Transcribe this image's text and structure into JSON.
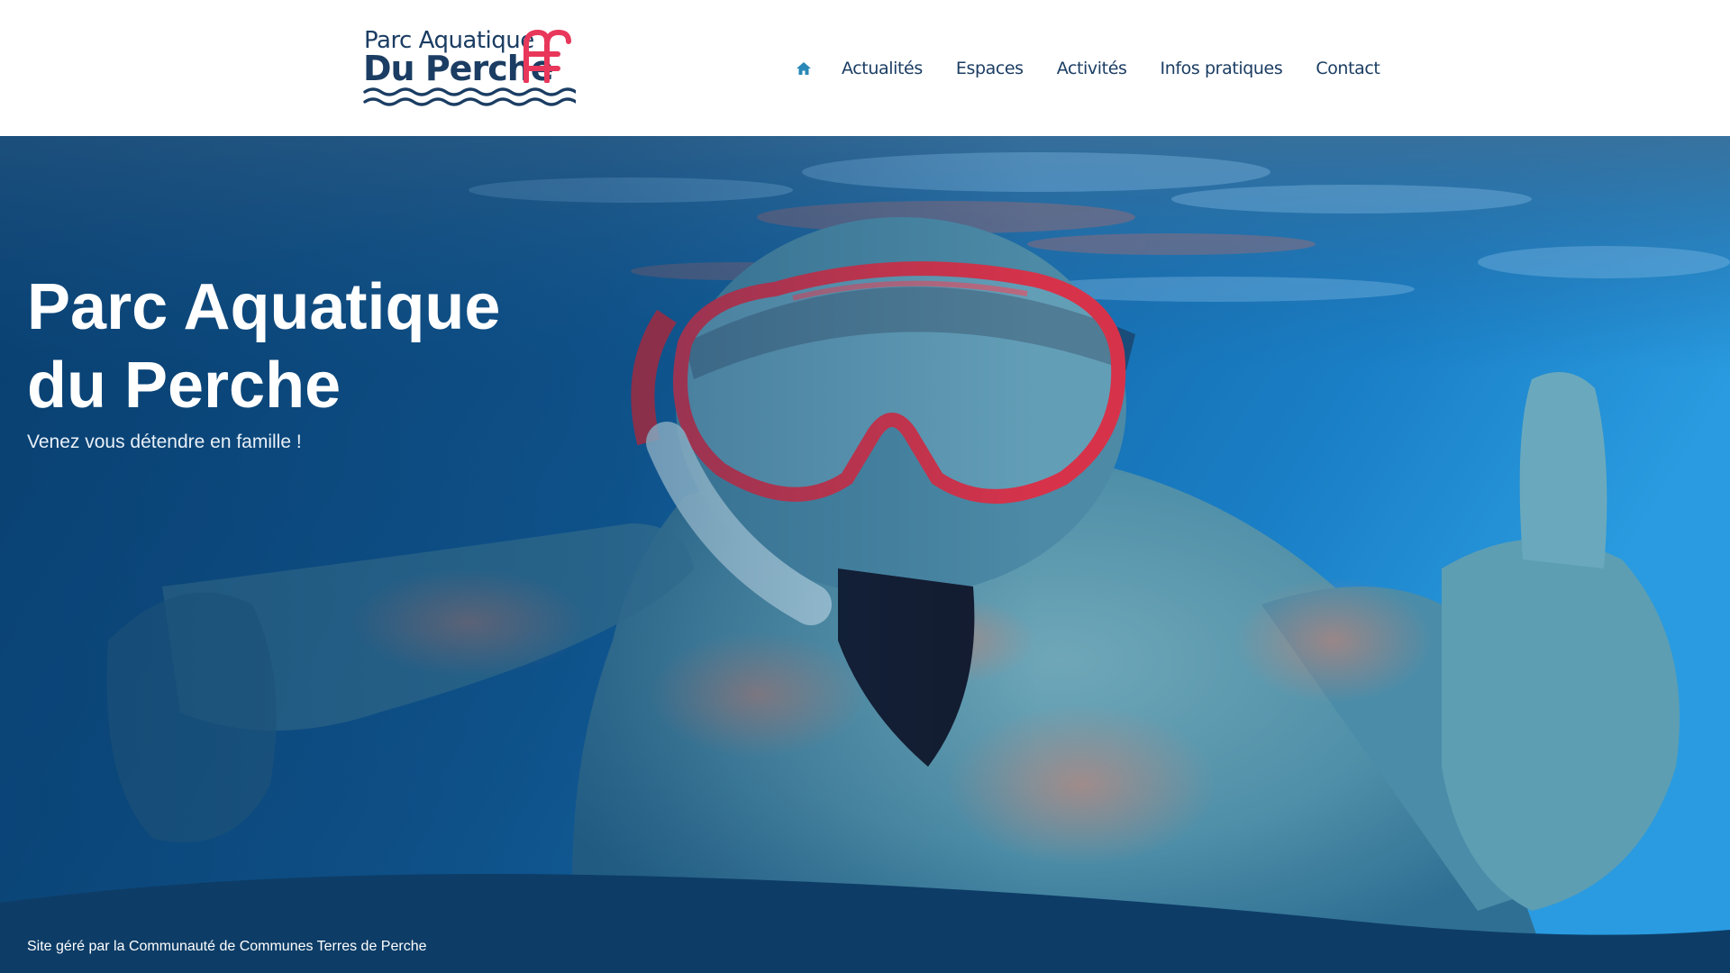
{
  "header": {
    "logo": {
      "line1": "Parc Aquatique",
      "line2": "Du Perche"
    },
    "nav": {
      "home_icon": "home-icon",
      "items": [
        {
          "label": "Actualités"
        },
        {
          "label": "Espaces"
        },
        {
          "label": "Activités"
        },
        {
          "label": "Infos pratiques"
        },
        {
          "label": "Contact"
        }
      ]
    }
  },
  "hero": {
    "title_line1": "Parc Aquatique",
    "title_line2": "du Perche",
    "subtitle": "Venez vous détendre en famille !",
    "image": "child-snorkeling-underwater-thumbs-up"
  },
  "footer": {
    "text": "Site géré par la Communauté de Communes Terres de Perche"
  },
  "colors": {
    "brand_navy": "#1b3d63",
    "brand_red": "#e8375a",
    "nav_home_accent": "#2a88b8",
    "footer_band": "#0d3d67"
  }
}
